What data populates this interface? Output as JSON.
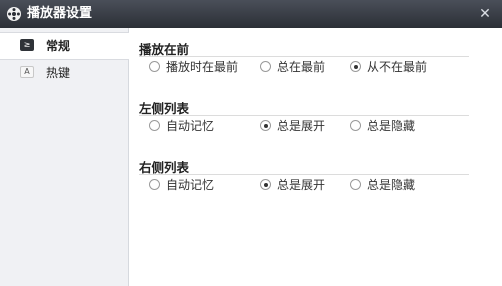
{
  "window": {
    "title": "播放器设置",
    "close_glyph": "✕"
  },
  "sidebar": {
    "items": [
      {
        "label": "常规",
        "icon": "general-icon",
        "icon_glyph": "≥",
        "selected": true
      },
      {
        "label": "热键",
        "icon": "hotkey-icon",
        "icon_glyph": "A",
        "selected": false
      }
    ]
  },
  "sections": [
    {
      "title": "播放在前",
      "options": [
        {
          "label": "播放时在最前",
          "checked": false
        },
        {
          "label": "总在最前",
          "checked": false
        },
        {
          "label": "从不在最前",
          "checked": true
        }
      ]
    },
    {
      "title": "左侧列表",
      "options": [
        {
          "label": "自动记忆",
          "checked": false
        },
        {
          "label": "总是展开",
          "checked": true
        },
        {
          "label": "总是隐藏",
          "checked": false
        }
      ]
    },
    {
      "title": "右侧列表",
      "options": [
        {
          "label": "自动记忆",
          "checked": false
        },
        {
          "label": "总是展开",
          "checked": true
        },
        {
          "label": "总是隐藏",
          "checked": false
        }
      ]
    }
  ]
}
